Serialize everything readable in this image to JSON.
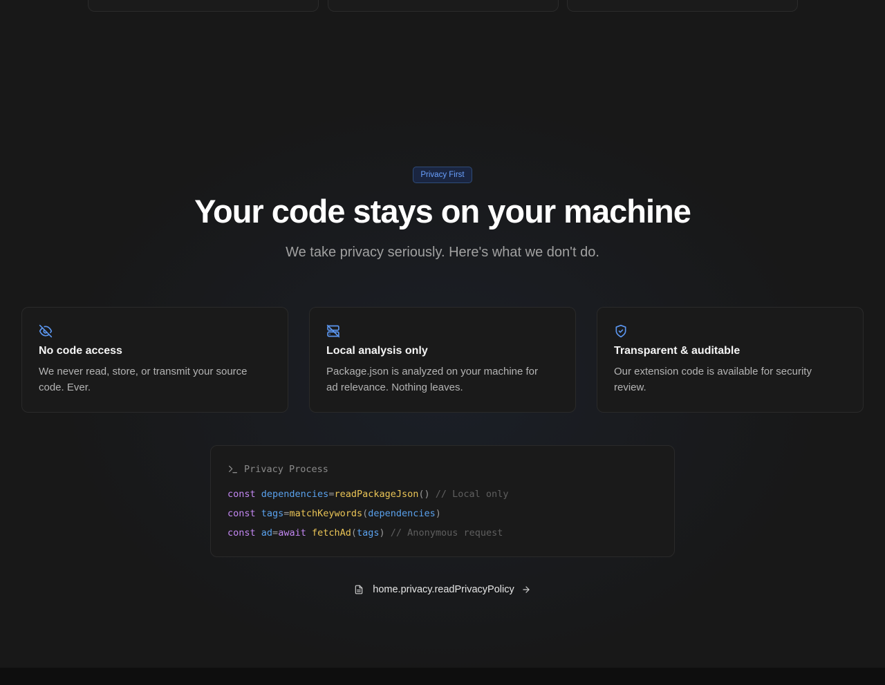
{
  "colors": {
    "accent": "#6aa1ff",
    "keyword": "#c387f2",
    "variable": "#5aa2ee",
    "function": "#ebc556",
    "comment": "#5f5f5f"
  },
  "badge": "Privacy First",
  "title": "Your code stays on your machine",
  "subtitle": "We take privacy seriously. Here's what we don't do.",
  "features": [
    {
      "icon": "eye-off-icon",
      "title": "No code access",
      "description": "We never read, store, or transmit your source code. Ever."
    },
    {
      "icon": "server-off-icon",
      "title": "Local analysis only",
      "description": "Package.json is analyzed on your machine for ad relevance. Nothing leaves."
    },
    {
      "icon": "shield-check-icon",
      "title": "Transparent & auditable",
      "description": "Our extension code is available for security review."
    }
  ],
  "code": {
    "header_icon": "terminal-icon",
    "header": "Privacy Process",
    "lines": [
      [
        {
          "t": "const",
          "c": "kw"
        },
        {
          "t": " ",
          "c": "pun"
        },
        {
          "t": "dependencies",
          "c": "var"
        },
        {
          "t": "=",
          "c": "pun"
        },
        {
          "t": "readPackageJson",
          "c": "fn"
        },
        {
          "t": "()",
          "c": "pun"
        },
        {
          "t": " // Local only",
          "c": "cm"
        }
      ],
      [
        {
          "t": "const",
          "c": "kw"
        },
        {
          "t": " ",
          "c": "pun"
        },
        {
          "t": "tags",
          "c": "var"
        },
        {
          "t": "=",
          "c": "pun"
        },
        {
          "t": "matchKeywords",
          "c": "fn"
        },
        {
          "t": "(",
          "c": "pun"
        },
        {
          "t": "dependencies",
          "c": "var"
        },
        {
          "t": ")",
          "c": "pun"
        }
      ],
      [
        {
          "t": "const",
          "c": "kw"
        },
        {
          "t": " ",
          "c": "pun"
        },
        {
          "t": "ad",
          "c": "var"
        },
        {
          "t": "=",
          "c": "pun"
        },
        {
          "t": "await",
          "c": "kw"
        },
        {
          "t": " ",
          "c": "pun"
        },
        {
          "t": "fetchAd",
          "c": "fn"
        },
        {
          "t": "(",
          "c": "pun"
        },
        {
          "t": "tags",
          "c": "var"
        },
        {
          "t": ")",
          "c": "pun"
        },
        {
          "t": " // Anonymous request",
          "c": "cm"
        }
      ]
    ]
  },
  "privacy_link": {
    "icon": "document-icon",
    "label": "home.privacy.readPrivacyPolicy",
    "arrow_icon": "arrow-right-icon"
  }
}
